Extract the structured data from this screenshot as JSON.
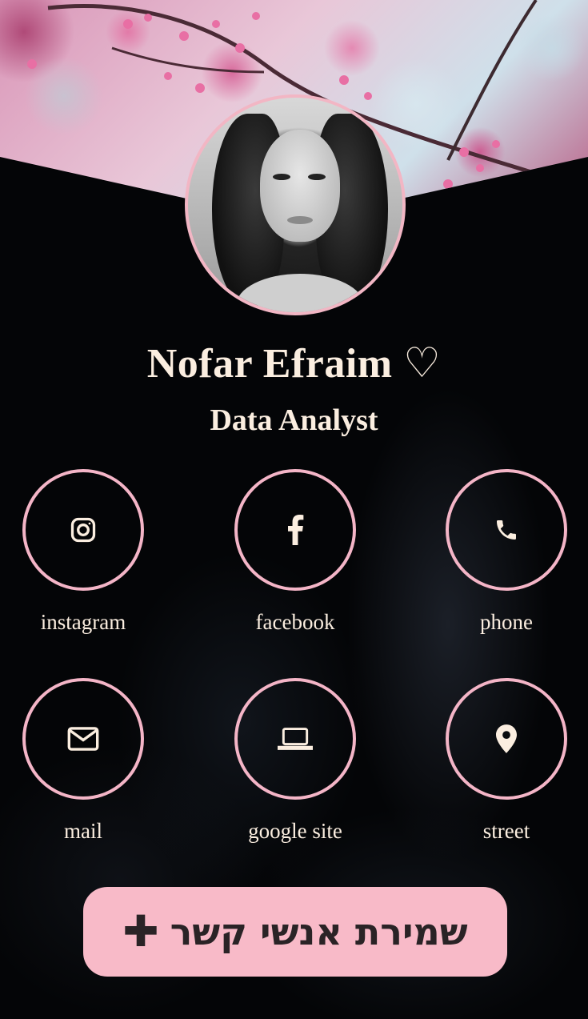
{
  "profile": {
    "name": "Nofar Efraim",
    "heart": "♡",
    "title": "Data Analyst"
  },
  "links": [
    {
      "label": "instagram",
      "icon": "instagram-icon"
    },
    {
      "label": "facebook",
      "icon": "facebook-icon"
    },
    {
      "label": "phone",
      "icon": "phone-icon"
    },
    {
      "label": "mail",
      "icon": "mail-icon"
    },
    {
      "label": "google site",
      "icon": "laptop-icon"
    },
    {
      "label": "street",
      "icon": "map-pin-icon"
    }
  ],
  "save_contact": {
    "label": "שמירת אנשי קשר",
    "icon": "plus-icon",
    "plus": "✚"
  },
  "colors": {
    "accent": "#f4b5c7",
    "button_bg": "#f8bac8",
    "text": "#fbeee0",
    "background": "#040507"
  }
}
